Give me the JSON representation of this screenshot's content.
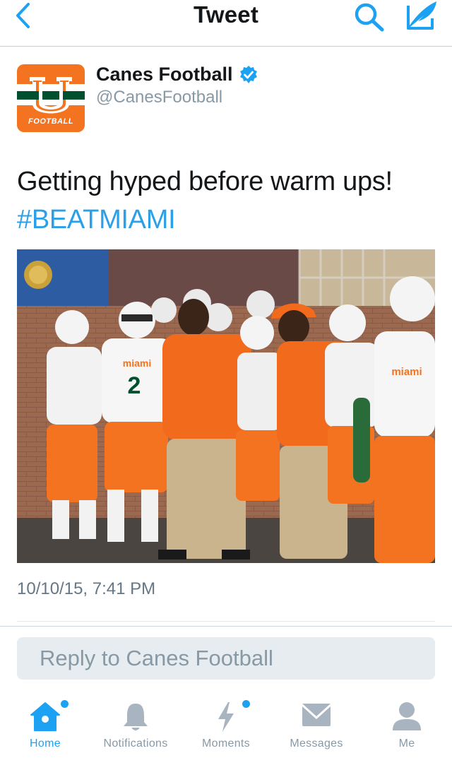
{
  "colors": {
    "accent": "#1da1f2",
    "hashtag": "#2ba0e8",
    "muted": "#8899a6",
    "text": "#14171a",
    "canes_orange": "#f47321",
    "canes_green": "#005030"
  },
  "header": {
    "title": "Tweet",
    "back_icon": "chevron-left-icon",
    "search_icon": "search-icon",
    "compose_icon": "compose-feather-icon"
  },
  "tweet": {
    "author_name": "Canes Football",
    "author_handle": "@CanesFootball",
    "avatar_text": "FOOTBALL",
    "verified": true,
    "text": "Getting hyped before warm ups!",
    "hashtag": "#BEATMIAMI",
    "media_description_icon": "photo",
    "jersey_number": "2",
    "jersey_text": "miami",
    "timestamp": "10/10/15, 7:41 PM"
  },
  "reply": {
    "placeholder": "Reply to Canes Football"
  },
  "tabbar": {
    "tabs": [
      {
        "label": "Home",
        "icon": "home-icon",
        "active": true,
        "dot": true
      },
      {
        "label": "Notifications",
        "icon": "bell-icon",
        "active": false,
        "dot": false
      },
      {
        "label": "Moments",
        "icon": "lightning-icon",
        "active": false,
        "dot": true
      },
      {
        "label": "Messages",
        "icon": "envelope-icon",
        "active": false,
        "dot": false
      },
      {
        "label": "Me",
        "icon": "person-icon",
        "active": false,
        "dot": false
      }
    ]
  }
}
